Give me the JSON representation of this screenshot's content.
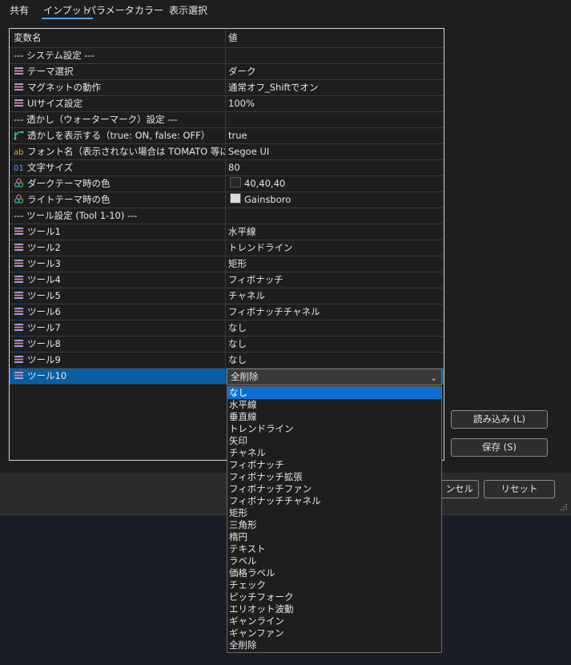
{
  "tabs": [
    "共有",
    "インプット",
    "パラメータ",
    "カラー",
    "表示選択"
  ],
  "active_tab": "インプット",
  "grid": {
    "headers": [
      "変数名",
      "値"
    ],
    "rows": [
      {
        "type": "section",
        "label": "--- システム設定 ---"
      },
      {
        "type": "param",
        "icon": "list-icon",
        "label": "テーマ選択",
        "value": "ダーク"
      },
      {
        "type": "param",
        "icon": "list-icon",
        "label": "マグネットの動作",
        "value": "通常オフ_Shiftでオン"
      },
      {
        "type": "param",
        "icon": "list-icon",
        "label": "UIサイズ設定",
        "value": "100%"
      },
      {
        "type": "section",
        "label": "--- 透かし（ウォーターマーク）設定 ---"
      },
      {
        "type": "param",
        "icon": "bool-icon",
        "label": "透かしを表示する（true: ON, false: OFF）",
        "value": "true"
      },
      {
        "type": "param",
        "icon": "text-icon",
        "label": "フォント名（表示されない場合は TOMATO 等に...",
        "value": "Segoe UI"
      },
      {
        "type": "param",
        "icon": "number-icon",
        "label": "文字サイズ",
        "value": "80"
      },
      {
        "type": "param",
        "icon": "color-icon",
        "label": "ダークテーマ時の色",
        "value": "40,40,40",
        "swatch": "#282828"
      },
      {
        "type": "param",
        "icon": "color-icon",
        "label": "ライトテーマ時の色",
        "value": "Gainsboro",
        "swatch": "#dcdcdc"
      },
      {
        "type": "section",
        "label": "--- ツール設定 (Tool 1-10) ---"
      },
      {
        "type": "param",
        "icon": "list-icon",
        "label": "ツール1",
        "value": "水平線"
      },
      {
        "type": "param",
        "icon": "list-icon",
        "label": "ツール2",
        "value": "トレンドライン"
      },
      {
        "type": "param",
        "icon": "list-icon",
        "label": "ツール3",
        "value": "矩形"
      },
      {
        "type": "param",
        "icon": "list-icon",
        "label": "ツール4",
        "value": "フィボナッチ"
      },
      {
        "type": "param",
        "icon": "list-icon",
        "label": "ツール5",
        "value": "チャネル"
      },
      {
        "type": "param",
        "icon": "list-icon",
        "label": "ツール6",
        "value": "フィボナッチチャネル"
      },
      {
        "type": "param",
        "icon": "list-icon",
        "label": "ツール7",
        "value": "なし"
      },
      {
        "type": "param",
        "icon": "list-icon",
        "label": "ツール8",
        "value": "なし"
      },
      {
        "type": "param",
        "icon": "list-icon",
        "label": "ツール9",
        "value": "なし"
      },
      {
        "type": "param",
        "icon": "list-icon",
        "label": "ツール10",
        "value": "",
        "selected": true
      }
    ]
  },
  "combo": {
    "value": "全削除"
  },
  "dropdown": {
    "highlighted": "なし",
    "options": [
      "なし",
      "水平線",
      "垂直線",
      "トレンドライン",
      "矢印",
      "チャネル",
      "フィボナッチ",
      "フィボナッチ拡張",
      "フィボナッチファン",
      "フィボナッチチャネル",
      "矩形",
      "三角形",
      "楕円",
      "テキスト",
      "ラベル",
      "価格ラベル",
      "チェック",
      "ピッチフォーク",
      "エリオット波動",
      "ギャンライン",
      "ギャンファン",
      "全削除"
    ]
  },
  "buttons": {
    "load": "読み込み (L)",
    "save": "保存 (S)",
    "cancel_partial": "ンセル",
    "reset": "リセット"
  },
  "colors": {
    "accent": "#4aa3ff",
    "selected_row": "#0a5fa3",
    "highlight": "#0a6fd1"
  }
}
